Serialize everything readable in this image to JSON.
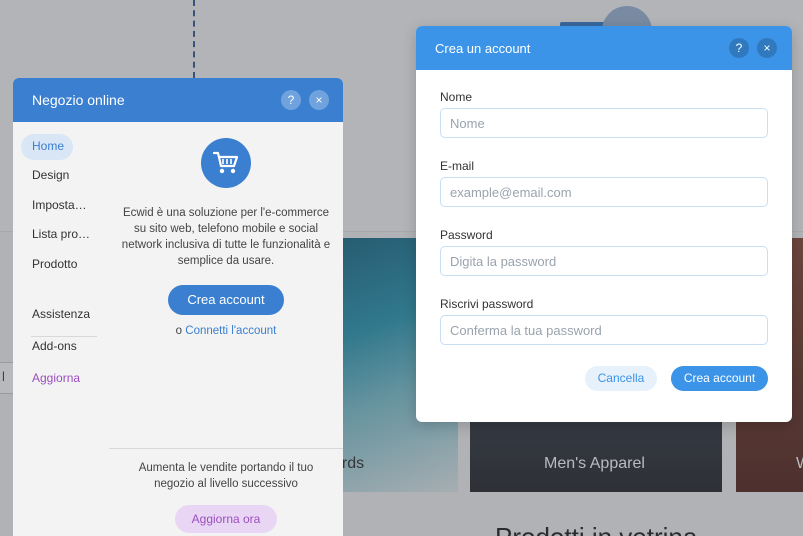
{
  "background_site": {
    "tiles": [
      {
        "label": "ards"
      },
      {
        "label": "Men's Apparel"
      },
      {
        "label": "W"
      }
    ],
    "section_title": "Prodotti in vetrina",
    "left_fragment": "l"
  },
  "ecwid_panel": {
    "title": "Negozio online",
    "help_icon": "?",
    "close_icon": "×",
    "nav": [
      {
        "label": "Home",
        "active": true
      },
      {
        "label": "Design"
      },
      {
        "label": "Imposta…"
      },
      {
        "label": "Lista pro…"
      },
      {
        "label": "Prodotto"
      },
      {
        "label": "Assistenza"
      },
      {
        "label": "Add-ons"
      },
      {
        "label": "Aggiorna"
      }
    ],
    "logo_icon": "shopping-cart-icon",
    "description": "Ecwid è una soluzione per l'e-commerce su sito web, telefono mobile e social network inclusiva di tutte le funzionalità e semplice da usare.",
    "create_button": "Crea account",
    "connect_prefix": "o",
    "connect_link": "Connetti l'account",
    "upsell_text": "Aumenta le vendite portando il tuo negozio al livello successivo",
    "upgrade_button": "Aggiorna ora"
  },
  "create_account_modal": {
    "title": "Crea un account",
    "help_icon": "?",
    "close_icon": "×",
    "fields": {
      "name": {
        "label": "Nome",
        "placeholder": "Nome",
        "value": ""
      },
      "email": {
        "label": "E-mail",
        "placeholder": "example@email.com",
        "value": ""
      },
      "password": {
        "label": "Password",
        "placeholder": "Digita la password",
        "value": ""
      },
      "confirm_password": {
        "label": "Riscrivi password",
        "placeholder": "Conferma la tua password",
        "value": ""
      }
    },
    "cancel_button": "Cancella",
    "submit_button": "Crea account"
  },
  "colors": {
    "panel_header": "#3a7fd0",
    "modal_header": "#3b94e8",
    "upgrade_accent": "#9b4fbf"
  }
}
